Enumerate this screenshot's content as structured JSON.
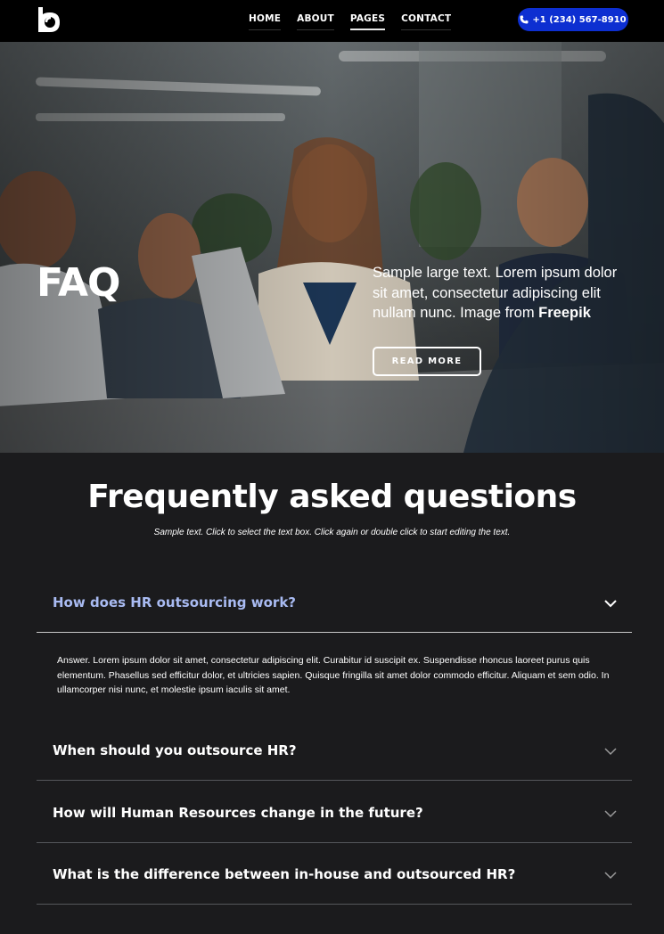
{
  "header": {
    "nav": [
      {
        "label": "HOME",
        "active": false
      },
      {
        "label": "ABOUT",
        "active": false
      },
      {
        "label": "PAGES",
        "active": true
      },
      {
        "label": "CONTACT",
        "active": false
      }
    ],
    "phone": "+1 (234) 567-8910",
    "phone_icon": "phone-icon",
    "logo_icon": "logo-icon"
  },
  "hero": {
    "title": "FAQ",
    "text": "Sample large text. Lorem ipsum dolor sit amet, consectetur adipiscing elit nullam nunc. Image from ",
    "credit": "Freepik",
    "button": "READ MORE"
  },
  "faq": {
    "title": "Frequently asked questions",
    "subtitle": "Sample text. Click to select the text box. Click again or double click to start editing the text.",
    "items": [
      {
        "question": "How does HR outsourcing work?",
        "open": true
      },
      {
        "question": "When should you outsource HR?",
        "open": false
      },
      {
        "question": "How will Human Resources change in the future?",
        "open": false
      },
      {
        "question": "What is the difference between in-house and outsourced HR?",
        "open": false
      }
    ],
    "answer": "Answer. Lorem ipsum dolor sit amet, consectetur adipiscing elit. Curabitur id suscipit ex. Suspendisse rhoncus laoreet purus quis elementum. Phasellus sed efficitur dolor, et ultricies sapien. Quisque fringilla sit amet dolor commodo efficitur. Aliquam et sem odio. In ullamcorper nisi nunc, et molestie ipsum iaculis sit amet."
  },
  "colors": {
    "header_bg": "#000000",
    "accent": "#0d2fd1",
    "page_bg": "#1b1b1d",
    "open_question": "#a9bbf2"
  }
}
